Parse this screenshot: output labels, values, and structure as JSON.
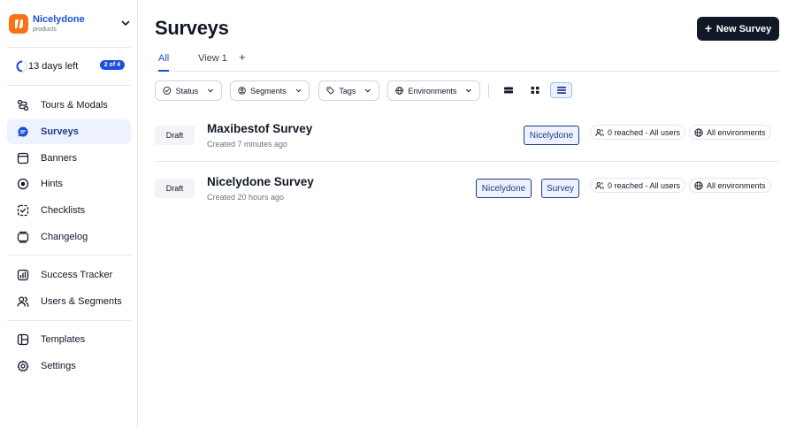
{
  "brand": {
    "name": "Nicelydone",
    "subtitle": "products"
  },
  "trial": {
    "text": "13 days left",
    "badge": "2 of 4"
  },
  "nav": {
    "group1": [
      {
        "id": "tours",
        "label": "Tours & Modals",
        "icon": "route-icon"
      },
      {
        "id": "surveys",
        "label": "Surveys",
        "icon": "survey-icon",
        "active": true
      },
      {
        "id": "banners",
        "label": "Banners",
        "icon": "banner-icon"
      },
      {
        "id": "hints",
        "label": "Hints",
        "icon": "hint-icon"
      },
      {
        "id": "checklists",
        "label": "Checklists",
        "icon": "checklist-icon"
      },
      {
        "id": "changelog",
        "label": "Changelog",
        "icon": "changelog-icon"
      }
    ],
    "group2": [
      {
        "id": "success-tracker",
        "label": "Success Tracker",
        "icon": "chart-icon"
      },
      {
        "id": "users-segments",
        "label": "Users & Segments",
        "icon": "users-icon"
      }
    ],
    "group3": [
      {
        "id": "templates",
        "label": "Templates",
        "icon": "templates-icon"
      },
      {
        "id": "settings",
        "label": "Settings",
        "icon": "gear-icon"
      }
    ]
  },
  "header": {
    "title": "Surveys",
    "new_button": "New Survey"
  },
  "tabs": [
    {
      "label": "All",
      "active": true
    },
    {
      "label": "View 1",
      "active": false
    }
  ],
  "tab_add": "+",
  "filters": {
    "status": "Status",
    "segments": "Segments",
    "tags": "Tags",
    "environments": "Environments"
  },
  "surveys": [
    {
      "status": "Draft",
      "title": "Maxibestof Survey",
      "created": "Created 7 minutes ago",
      "tags": [
        "Nicelydone"
      ],
      "reach": "0 reached - All users",
      "environments": "All environments"
    },
    {
      "status": "Draft",
      "title": "Nicelydone Survey",
      "created": "Created 20 hours ago",
      "tags": [
        "Nicelydone",
        "Survey"
      ],
      "reach": "0 reached - All users",
      "environments": "All environments"
    }
  ],
  "colors": {
    "accent": "#1d4ed8",
    "brand": "#f97316",
    "dark": "#111827",
    "active_bg": "#eef2ff"
  }
}
